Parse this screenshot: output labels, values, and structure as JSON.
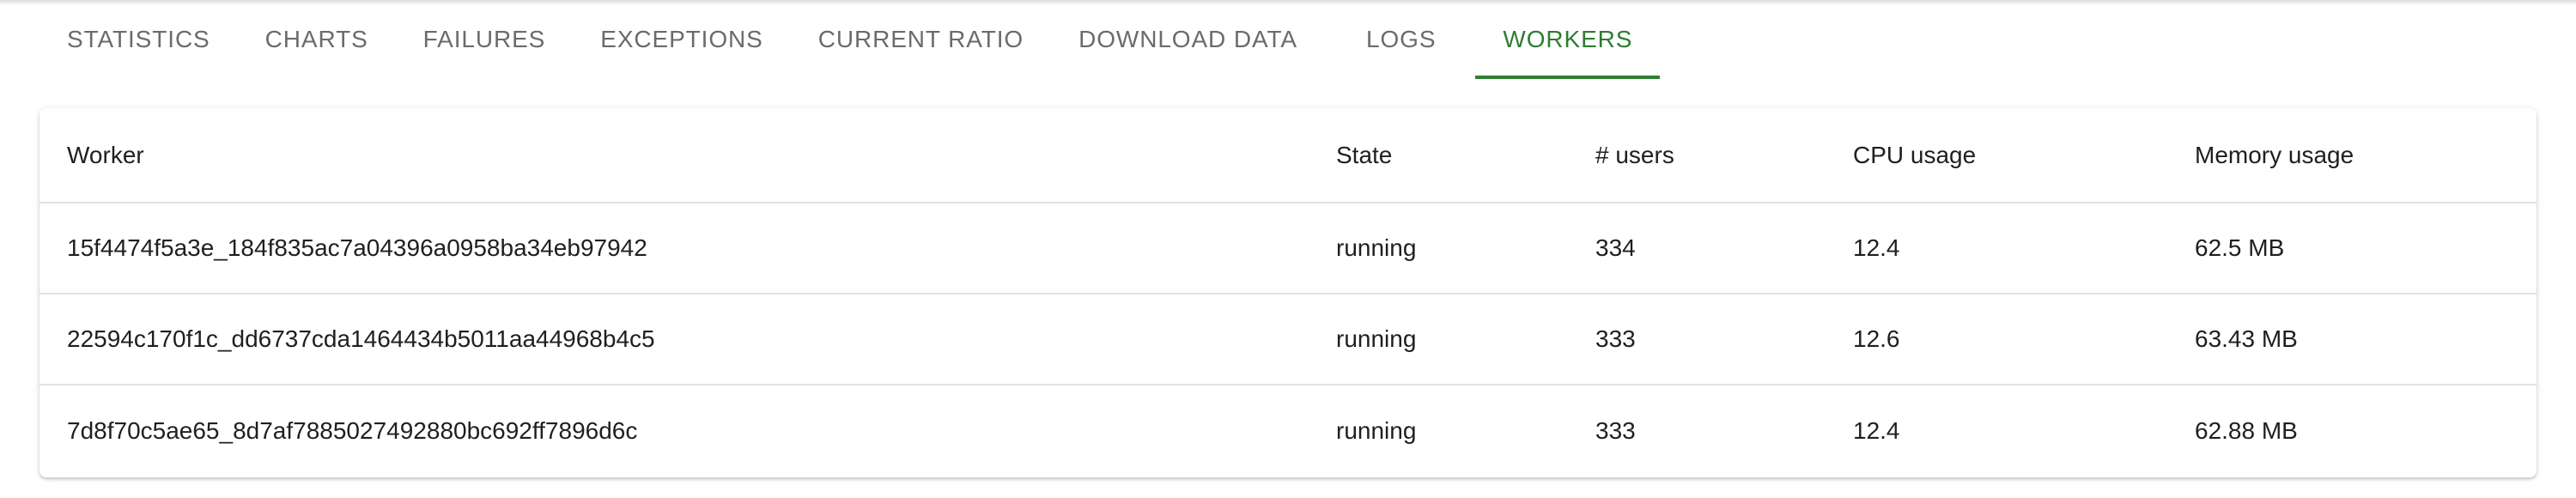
{
  "tabs": [
    {
      "label": "STATISTICS"
    },
    {
      "label": "CHARTS"
    },
    {
      "label": "FAILURES"
    },
    {
      "label": "EXCEPTIONS"
    },
    {
      "label": "CURRENT RATIO"
    },
    {
      "label": "DOWNLOAD DATA"
    },
    {
      "label": "LOGS"
    },
    {
      "label": "WORKERS",
      "active": true
    }
  ],
  "colors": {
    "accent": "#2e7d32",
    "tab_inactive": "#6b6b6b",
    "divider": "#e2e2e2"
  },
  "workers_table": {
    "headers": [
      "Worker",
      "State",
      "# users",
      "CPU usage",
      "Memory usage"
    ],
    "rows": [
      [
        "15f4474f5a3e_184f835ac7a04396a0958ba34eb97942",
        "running",
        "334",
        "12.4",
        "62.5 MB"
      ],
      [
        "22594c170f1c_dd6737cda1464434b5011aa44968b4c5",
        "running",
        "333",
        "12.6",
        "63.43 MB"
      ],
      [
        "7d8f70c5ae65_8d7af7885027492880bc692ff7896d6c",
        "running",
        "333",
        "12.4",
        "62.88 MB"
      ]
    ]
  }
}
